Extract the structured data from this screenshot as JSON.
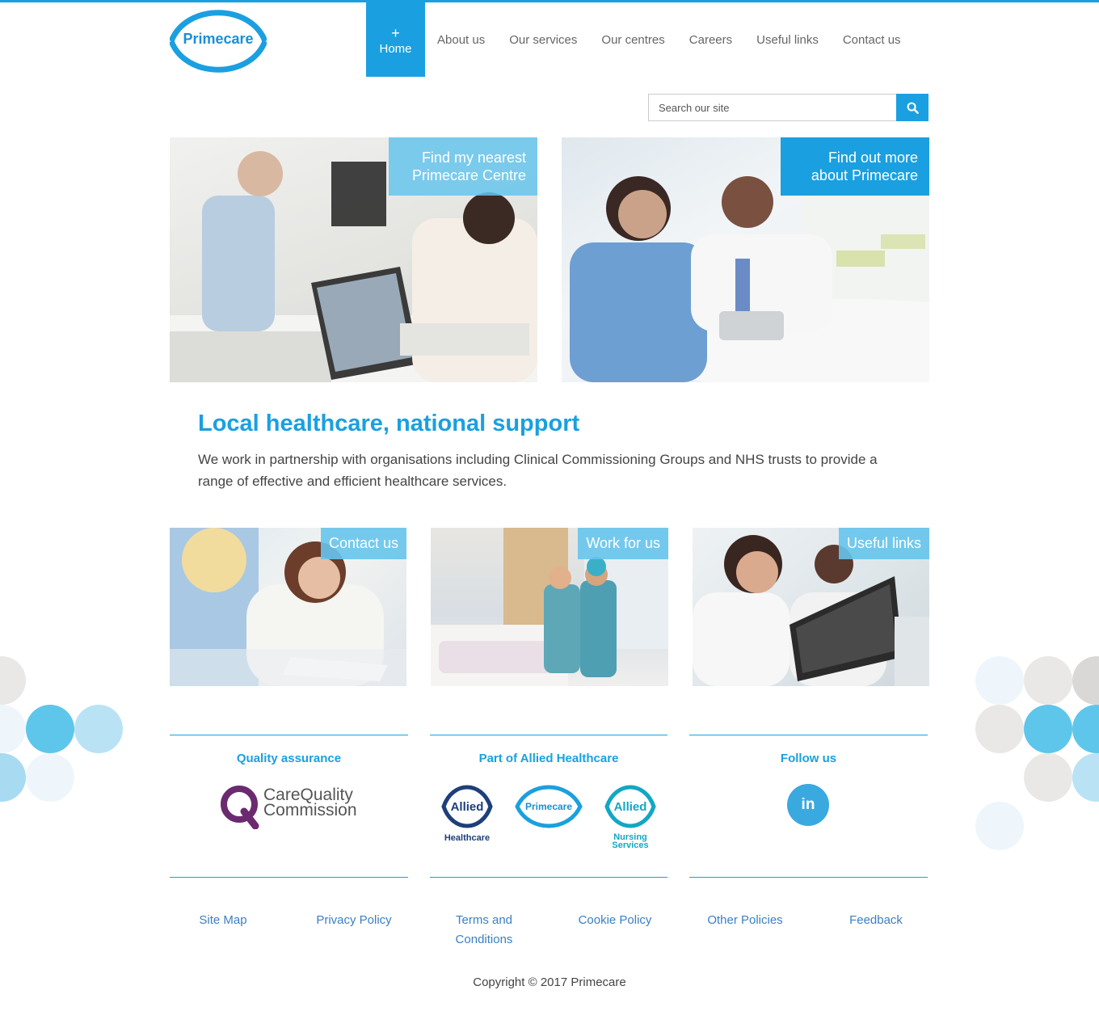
{
  "brand": {
    "logo_text": "Primecare"
  },
  "nav": {
    "items": [
      {
        "label": "Home",
        "icon": "+"
      },
      {
        "label": "About us"
      },
      {
        "label": "Our services"
      },
      {
        "label": "Our centres"
      },
      {
        "label": "Careers"
      },
      {
        "label": "Useful links"
      },
      {
        "label": "Contact us"
      }
    ]
  },
  "search": {
    "placeholder": "Search our site",
    "icon": "search-icon"
  },
  "hero": [
    {
      "label": "Find my nearest Primecare Centre"
    },
    {
      "label": "Find out more about Primecare"
    }
  ],
  "intro": {
    "title": "Local healthcare, national support",
    "text": "We work in partnership with organisations including Clinical Commissioning Groups and NHS trusts to provide a range of effective and efficient healthcare services."
  },
  "tiles": [
    {
      "label": "Contact us"
    },
    {
      "label": "Work for us"
    },
    {
      "label": "Useful links"
    }
  ],
  "footer": {
    "columns": [
      {
        "title": "Quality assurance",
        "logo_text": "CareQuality Commission"
      },
      {
        "title": "Part of Allied Healthcare",
        "logos": [
          {
            "name": "Allied",
            "sub": "Healthcare"
          },
          {
            "name": "Primecare",
            "sub": ""
          },
          {
            "name": "Allied",
            "sub": "Nursing Services"
          }
        ]
      },
      {
        "title": "Follow us",
        "social": "in"
      }
    ],
    "links": [
      "Site Map",
      "Privacy Policy",
      "Terms and Conditions",
      "Cookie Policy",
      "Other Policies",
      "Feedback"
    ],
    "copyright": "Copyright © 2017 Primecare"
  },
  "colors": {
    "accent": "#1aa0e0",
    "accent_light": "#66c4ec",
    "link": "#3b7fc4",
    "cqc_purple": "#6b2a6f"
  }
}
